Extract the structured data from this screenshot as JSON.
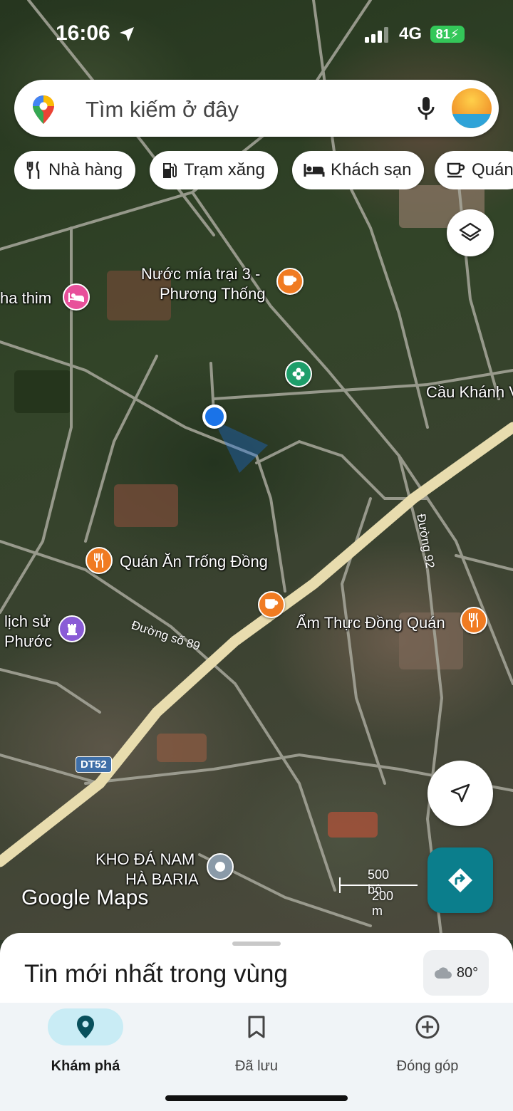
{
  "status_bar": {
    "time": "16:06",
    "network": "4G",
    "battery": "81"
  },
  "search": {
    "placeholder": "Tìm kiếm ở đây",
    "icons": [
      "google-maps-pin-icon",
      "mic-icon",
      "avatar"
    ]
  },
  "chips": [
    {
      "label": "Nhà hàng",
      "icon": "restaurant-icon"
    },
    {
      "label": "Trạm xăng",
      "icon": "gas-station-icon"
    },
    {
      "label": "Khách sạn",
      "icon": "hotel-icon"
    },
    {
      "label": "Quán",
      "icon": "cafe-icon"
    }
  ],
  "map": {
    "labels": {
      "nuoc_mia": "Nước mía trại 3 -",
      "nuoc_mia_2": "Phương Thống",
      "ha_thim": "ha thim",
      "cau_khanh": "Cầu Khánh V",
      "quan_an": "Quán Ăn Trống Đồng",
      "am_thuc": "Ẩm Thực Đồng Quán",
      "lich_su": "lịch sử",
      "phuoc": "Phước",
      "kho_da": "KHO ĐÁ NAM",
      "kho_da_2": "HÀ BARIA"
    },
    "road_labels": {
      "duong_so_89": "Đường số 89",
      "duong_92": "Đường 92",
      "dt52": "DT52"
    },
    "scale": {
      "imperial": "500 bộ",
      "metric": "200 m"
    },
    "attribution": "Google Maps"
  },
  "sheet": {
    "title": "Tin mới nhất trong vùng",
    "weather": "80°"
  },
  "nav": {
    "explore": "Khám phá",
    "saved": "Đã lưu",
    "contribute": "Đóng góp"
  },
  "colors": {
    "accent": "#1a73e8",
    "directions_button": "#0b7e8c",
    "nav_active_pill": "#c9ecf5",
    "battery": "#34c759",
    "restaurant_poi": "#f07b22",
    "hotel_poi": "#e84f9a",
    "landmark_poi": "#8a5cd6",
    "park_poi": "#1e9e6a"
  }
}
